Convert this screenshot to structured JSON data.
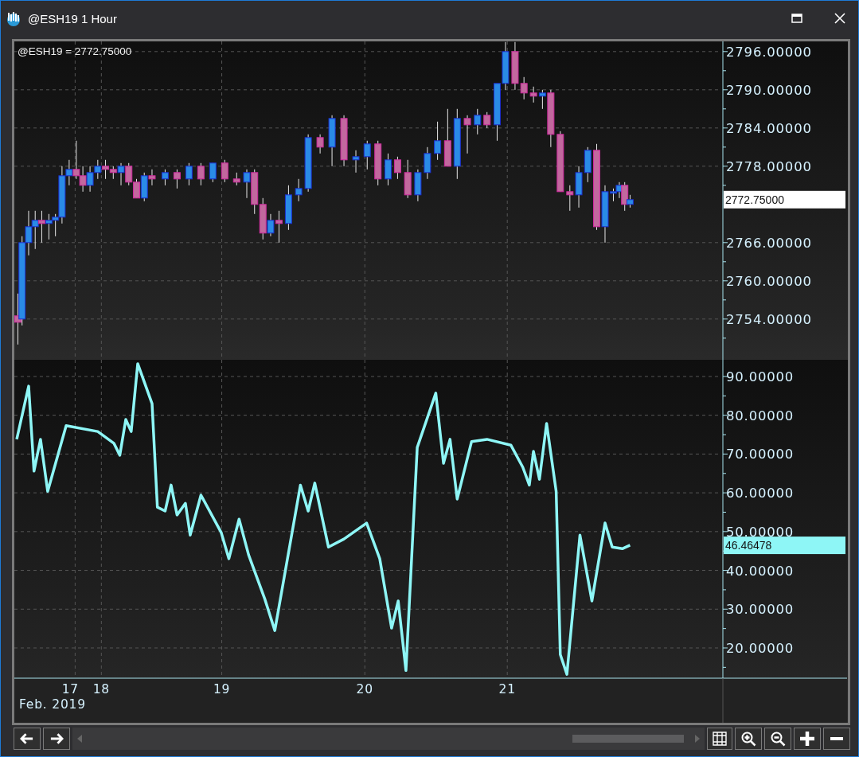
{
  "window": {
    "title": "@ESH19 1 Hour"
  },
  "price_pane": {
    "legend": "@ESH19 = 2772.75000",
    "axis_labels": [
      "2796.00000",
      "2790.00000",
      "2784.00000",
      "2778.00000",
      "2766.00000",
      "2760.00000",
      "2754.00000"
    ],
    "last_price": "2772.75000"
  },
  "oscillator_pane": {
    "axis_labels": [
      "90.00000",
      "80.00000",
      "70.00000",
      "60.00000",
      "50.00000",
      "40.00000",
      "30.00000",
      "20.00000"
    ],
    "last_value": "46.46478"
  },
  "time_axis": {
    "labels": [
      "17",
      "18",
      "19",
      "20",
      "21"
    ],
    "period": "Feb. 2019"
  }
}
